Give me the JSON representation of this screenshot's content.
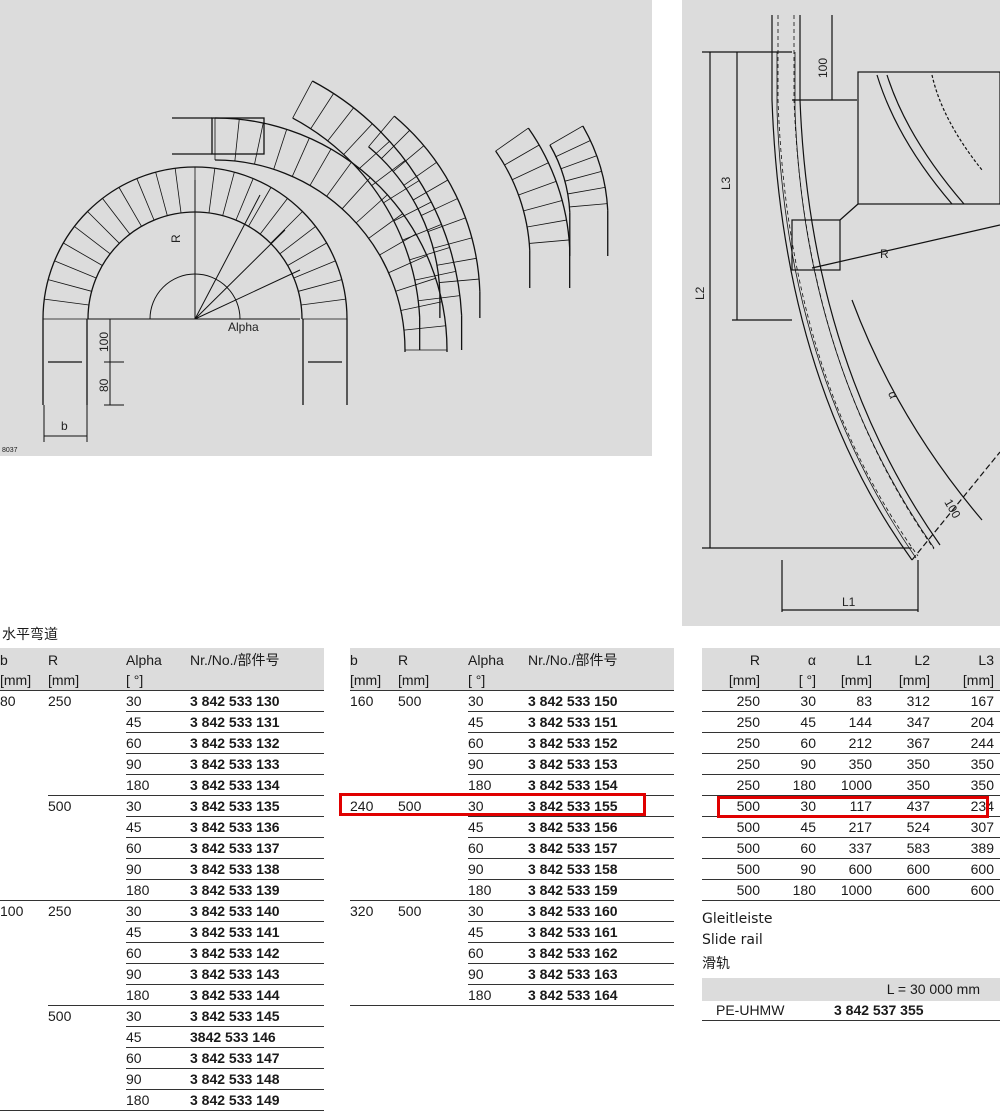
{
  "figures": {
    "left": {
      "labels": {
        "r": "R",
        "alpha": "Alpha",
        "dim100": "100",
        "dim80": "80",
        "b": "b"
      },
      "code": "8037"
    },
    "right": {
      "labels": {
        "dim100_top": "100",
        "l3": "L3",
        "l2": "L2",
        "r": "R",
        "alpha": "α",
        "dim100_bottom": "100",
        "l1": "L1"
      }
    }
  },
  "section_title": "水平弯道",
  "table_left": {
    "headers": {
      "b": "b",
      "b_unit": "[mm]",
      "r": "R",
      "r_unit": "[mm]",
      "alpha": "Alpha",
      "alpha_unit": "[ °]",
      "nr": "Nr./No./部件号"
    },
    "rows": [
      {
        "b": "80",
        "r": "250",
        "alpha": "30",
        "nr": "3 842 533 130"
      },
      {
        "b": "",
        "r": "",
        "alpha": "45",
        "nr": "3 842 533 131"
      },
      {
        "b": "",
        "r": "",
        "alpha": "60",
        "nr": "3 842 533 132"
      },
      {
        "b": "",
        "r": "",
        "alpha": "90",
        "nr": "3 842 533 133"
      },
      {
        "b": "",
        "r": "",
        "alpha": "180",
        "nr": "3 842 533 134"
      },
      {
        "b": "",
        "r": "500",
        "alpha": "30",
        "nr": "3 842 533 135"
      },
      {
        "b": "",
        "r": "",
        "alpha": "45",
        "nr": "3 842 533 136"
      },
      {
        "b": "",
        "r": "",
        "alpha": "60",
        "nr": "3 842 533 137"
      },
      {
        "b": "",
        "r": "",
        "alpha": "90",
        "nr": "3 842 533 138"
      },
      {
        "b": "",
        "r": "",
        "alpha": "180",
        "nr": "3 842 533 139"
      },
      {
        "b": "100",
        "r": "250",
        "alpha": "30",
        "nr": "3 842 533 140"
      },
      {
        "b": "",
        "r": "",
        "alpha": "45",
        "nr": "3 842 533 141"
      },
      {
        "b": "",
        "r": "",
        "alpha": "60",
        "nr": "3 842 533 142"
      },
      {
        "b": "",
        "r": "",
        "alpha": "90",
        "nr": "3 842 533 143"
      },
      {
        "b": "",
        "r": "",
        "alpha": "180",
        "nr": "3 842 533 144"
      },
      {
        "b": "",
        "r": "500",
        "alpha": "30",
        "nr": "3 842 533 145"
      },
      {
        "b": "",
        "r": "",
        "alpha": "45",
        "nr": "3842 533 146"
      },
      {
        "b": "",
        "r": "",
        "alpha": "60",
        "nr": "3 842 533 147"
      },
      {
        "b": "",
        "r": "",
        "alpha": "90",
        "nr": "3 842 533 148"
      },
      {
        "b": "",
        "r": "",
        "alpha": "180",
        "nr": "3 842 533 149"
      }
    ]
  },
  "table_middle": {
    "headers": {
      "b": "b",
      "b_unit": "[mm]",
      "r": "R",
      "r_unit": "[mm]",
      "alpha": "Alpha",
      "alpha_unit": "[ °]",
      "nr": "Nr./No./部件号"
    },
    "rows": [
      {
        "b": "160",
        "r": "500",
        "alpha": "30",
        "nr": "3 842 533 150"
      },
      {
        "b": "",
        "r": "",
        "alpha": "45",
        "nr": "3 842 533 151"
      },
      {
        "b": "",
        "r": "",
        "alpha": "60",
        "nr": "3 842 533 152"
      },
      {
        "b": "",
        "r": "",
        "alpha": "90",
        "nr": "3 842 533 153"
      },
      {
        "b": "",
        "r": "",
        "alpha": "180",
        "nr": "3 842 533 154"
      },
      {
        "b": "240",
        "r": "500",
        "alpha": "30",
        "nr": "3 842 533 155"
      },
      {
        "b": "",
        "r": "",
        "alpha": "45",
        "nr": "3 842 533 156"
      },
      {
        "b": "",
        "r": "",
        "alpha": "60",
        "nr": "3 842 533 157"
      },
      {
        "b": "",
        "r": "",
        "alpha": "90",
        "nr": "3 842 533 158"
      },
      {
        "b": "",
        "r": "",
        "alpha": "180",
        "nr": "3 842 533 159"
      },
      {
        "b": "320",
        "r": "500",
        "alpha": "30",
        "nr": "3 842 533 160"
      },
      {
        "b": "",
        "r": "",
        "alpha": "45",
        "nr": "3 842 533 161"
      },
      {
        "b": "",
        "r": "",
        "alpha": "60",
        "nr": "3 842 533 162"
      },
      {
        "b": "",
        "r": "",
        "alpha": "90",
        "nr": "3 842 533 163"
      },
      {
        "b": "",
        "r": "",
        "alpha": "180",
        "nr": "3 842 533 164"
      }
    ]
  },
  "table_right": {
    "headers": {
      "r": "R",
      "r_unit": "[mm]",
      "alpha": "α",
      "alpha_unit": "[ °]",
      "l1": "L1",
      "l1_unit": "[mm]",
      "l2": "L2",
      "l2_unit": "[mm]",
      "l3": "L3",
      "l3_unit": "[mm]"
    },
    "rows": [
      {
        "r": "250",
        "alpha": "30",
        "l1": "83",
        "l2": "312",
        "l3": "167"
      },
      {
        "r": "250",
        "alpha": "45",
        "l1": "144",
        "l2": "347",
        "l3": "204"
      },
      {
        "r": "250",
        "alpha": "60",
        "l1": "212",
        "l2": "367",
        "l3": "244"
      },
      {
        "r": "250",
        "alpha": "90",
        "l1": "350",
        "l2": "350",
        "l3": "350"
      },
      {
        "r": "250",
        "alpha": "180",
        "l1": "1000",
        "l2": "350",
        "l3": "350"
      },
      {
        "r": "500",
        "alpha": "30",
        "l1": "117",
        "l2": "437",
        "l3": "234"
      },
      {
        "r": "500",
        "alpha": "45",
        "l1": "217",
        "l2": "524",
        "l3": "307"
      },
      {
        "r": "500",
        "alpha": "60",
        "l1": "337",
        "l2": "583",
        "l3": "389"
      },
      {
        "r": "500",
        "alpha": "90",
        "l1": "600",
        "l2": "600",
        "l3": "600"
      },
      {
        "r": "500",
        "alpha": "180",
        "l1": "1000",
        "l2": "600",
        "l3": "600"
      }
    ]
  },
  "slide_rail": {
    "title_de": "Gleitleiste",
    "title_en": "Slide rail",
    "title_cn": "滑轨",
    "length_label": "L = 30 000 mm",
    "material": "PE-UHMW",
    "nr": "3 842 537 355"
  },
  "highlight_color": "#e00000"
}
